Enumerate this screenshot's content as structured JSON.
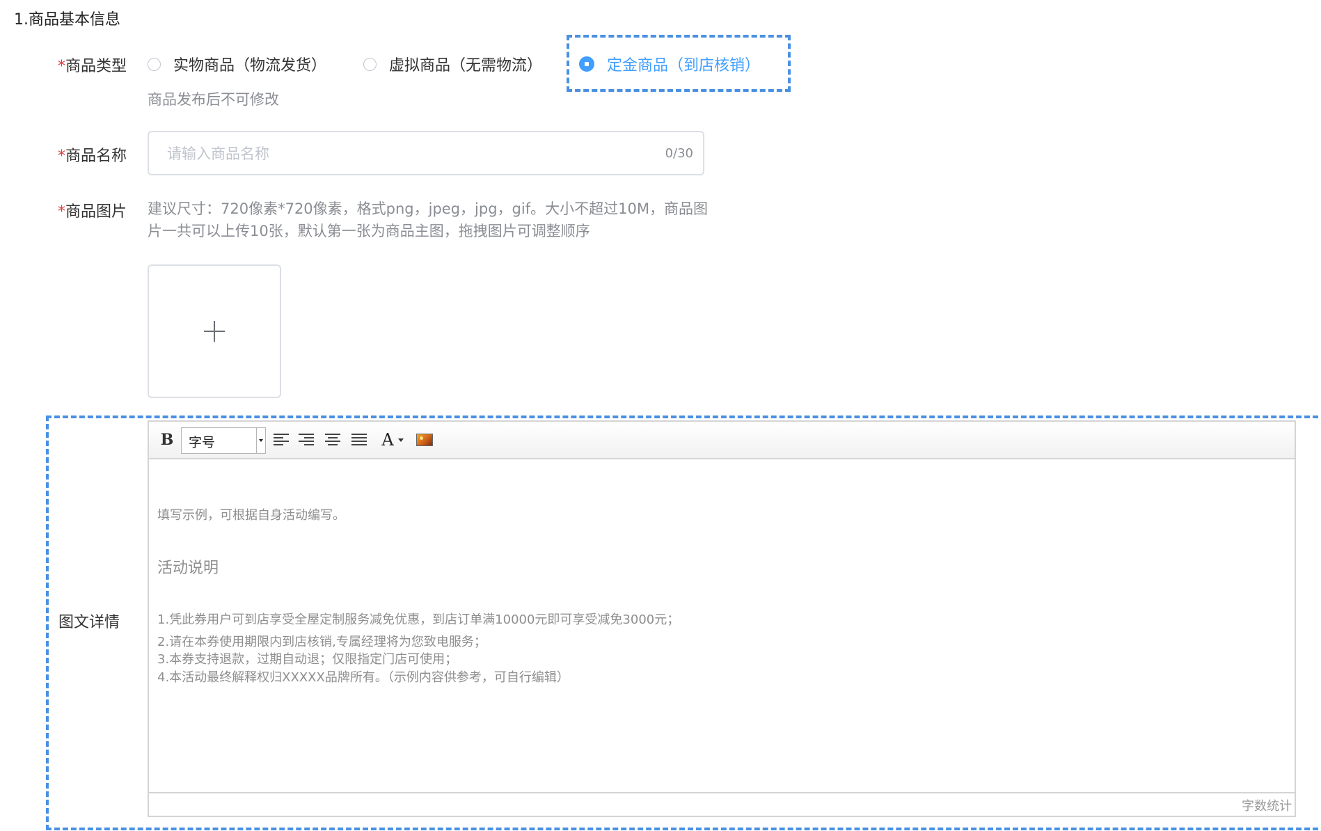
{
  "section": {
    "title": "1.商品基本信息"
  },
  "product_type": {
    "required_mark": "*",
    "label": "商品类型",
    "options": [
      {
        "label": "实物商品（物流发货）",
        "checked": false
      },
      {
        "label": "虚拟商品（无需物流）",
        "checked": false
      },
      {
        "label": "定金商品（到店核销）",
        "checked": true
      }
    ],
    "hint": "商品发布后不可修改"
  },
  "product_name": {
    "required_mark": "*",
    "label": "商品名称",
    "placeholder": "请输入商品名称",
    "value": "",
    "counter": "0/30"
  },
  "product_images": {
    "required_mark": "*",
    "label": "商品图片",
    "description": "建议尺寸：720像素*720像素，格式png，jpeg，jpg，gif。大小不超过10M，商品图片一共可以上传10张，默认第一张为商品主图，拖拽图片可调整顺序",
    "upload_icon": "plus-icon"
  },
  "detail": {
    "label": "图文详情",
    "toolbar": {
      "bold": "B",
      "font_size_label": "字号",
      "font_color": "A",
      "icons": [
        "bold-icon",
        "align-left-icon",
        "align-right-icon",
        "align-center-icon",
        "align-justify-icon",
        "font-color-icon",
        "insert-image-icon"
      ]
    },
    "content": {
      "intro": "填写示例，可根据自身活动编写。",
      "heading": "活动说明",
      "items": [
        "1.凭此券用户可到店享受全屋定制服务减免优惠，到店订单满10000元即可享受减免3000元；",
        "2.请在本券使用期限内到店核销,专属经理将为您致电服务；",
        "3.本券支持退款，过期自动退；仅限指定门店可使用；",
        "4.本活动最终解释权归XXXXX品牌所有。（示例内容供参考，可自行编辑）"
      ]
    },
    "word_count_label": "字数统计"
  },
  "colors": {
    "accent": "#409eff",
    "highlight_dash": "#4a90e2",
    "required": "#e4393c"
  }
}
